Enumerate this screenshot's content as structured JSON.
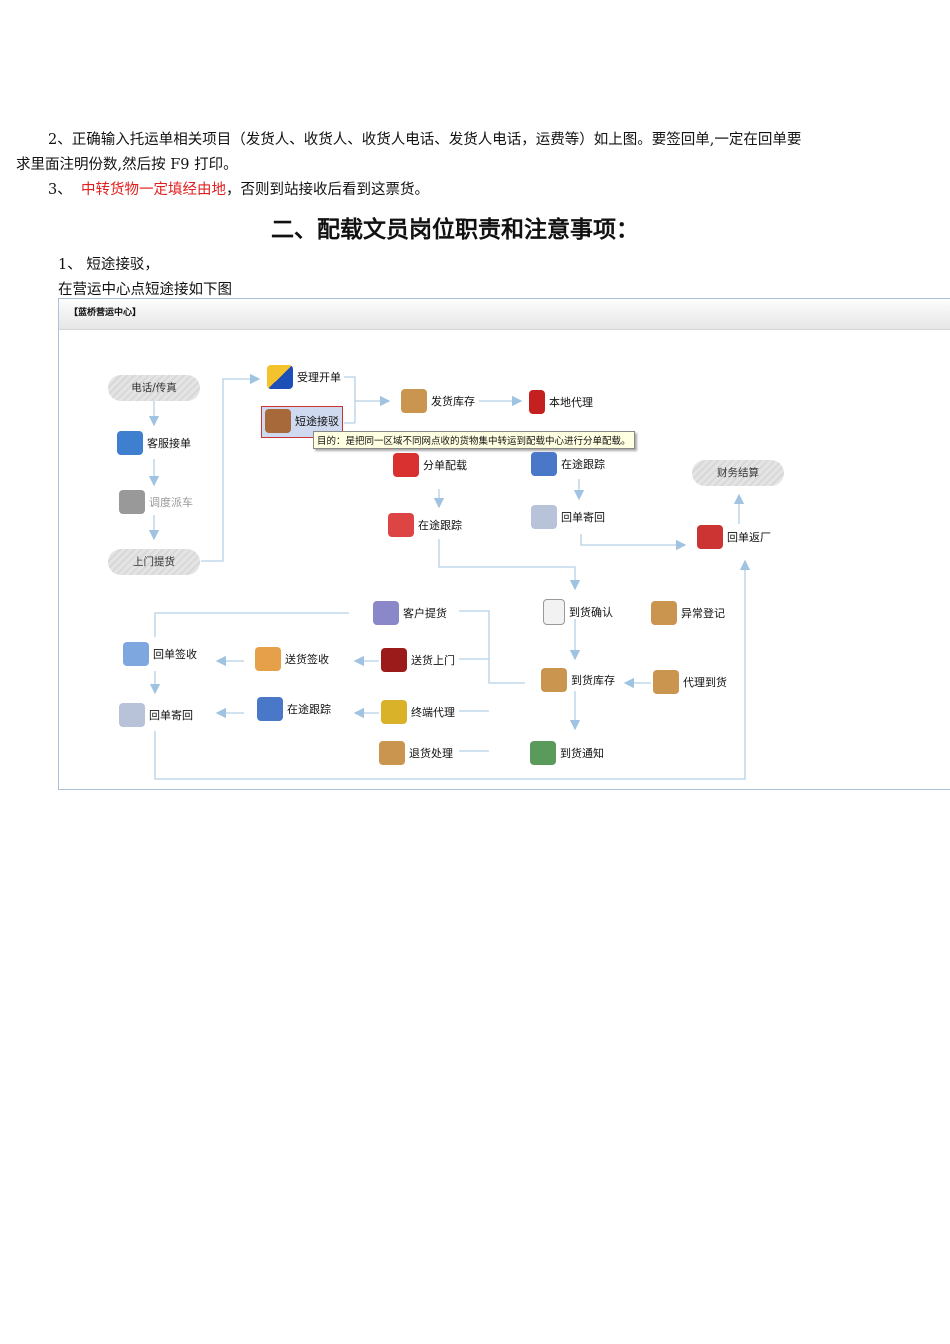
{
  "doc": {
    "para2_line1": "2、正确输入托运单相关项目（发货人、收货人、收货人电话、发货人电话，运费等）如上图。要签回单,一定在回单要",
    "para2_line2": "求里面注明份数,然后按 F9 打印。",
    "para3_num": "3、",
    "para3_red": "中转货物一定填经由地",
    "para3_rest": "，否则到站接收后看到这票货。",
    "heading": "二、配载文员岗位职责和注意事项：",
    "item1": "1、 短途接驳，",
    "item1_desc": "在营运中心点短途接如下图"
  },
  "diagram": {
    "title": "【蓝桥营运中心】",
    "tooltip": "目的：是把同一区域不同网点收的货物集中转运到配载中心进行分单配载。",
    "nodes": {
      "phone_fax": "电话/传真",
      "cs_order": "客服接单",
      "dispatch": "调度派车",
      "pickup": "上门提货",
      "accept_order": "受理开单",
      "short_transfer": "短途接驳",
      "ship_stock": "发货库存",
      "local_agent": "本地代理",
      "split_load": "分单配载",
      "tracking1": "在途跟踪",
      "tracking2": "在途跟踪",
      "receipt_return1": "回单寄回",
      "finance": "财务结算",
      "receipt_factory": "回单返厂",
      "customer_pickup": "客户提货",
      "arrival_confirm": "到货确认",
      "exception": "异常登记",
      "receipt_sign": "回单签收",
      "delivery_sign": "送货签收",
      "door_delivery": "送货上门",
      "arrival_stock": "到货库存",
      "agent_arrival": "代理到货",
      "receipt_return2": "回单寄回",
      "tracking3": "在途跟踪",
      "terminal_agent": "终端代理",
      "return_goods": "退货处理",
      "arrival_notice": "到货通知"
    }
  }
}
